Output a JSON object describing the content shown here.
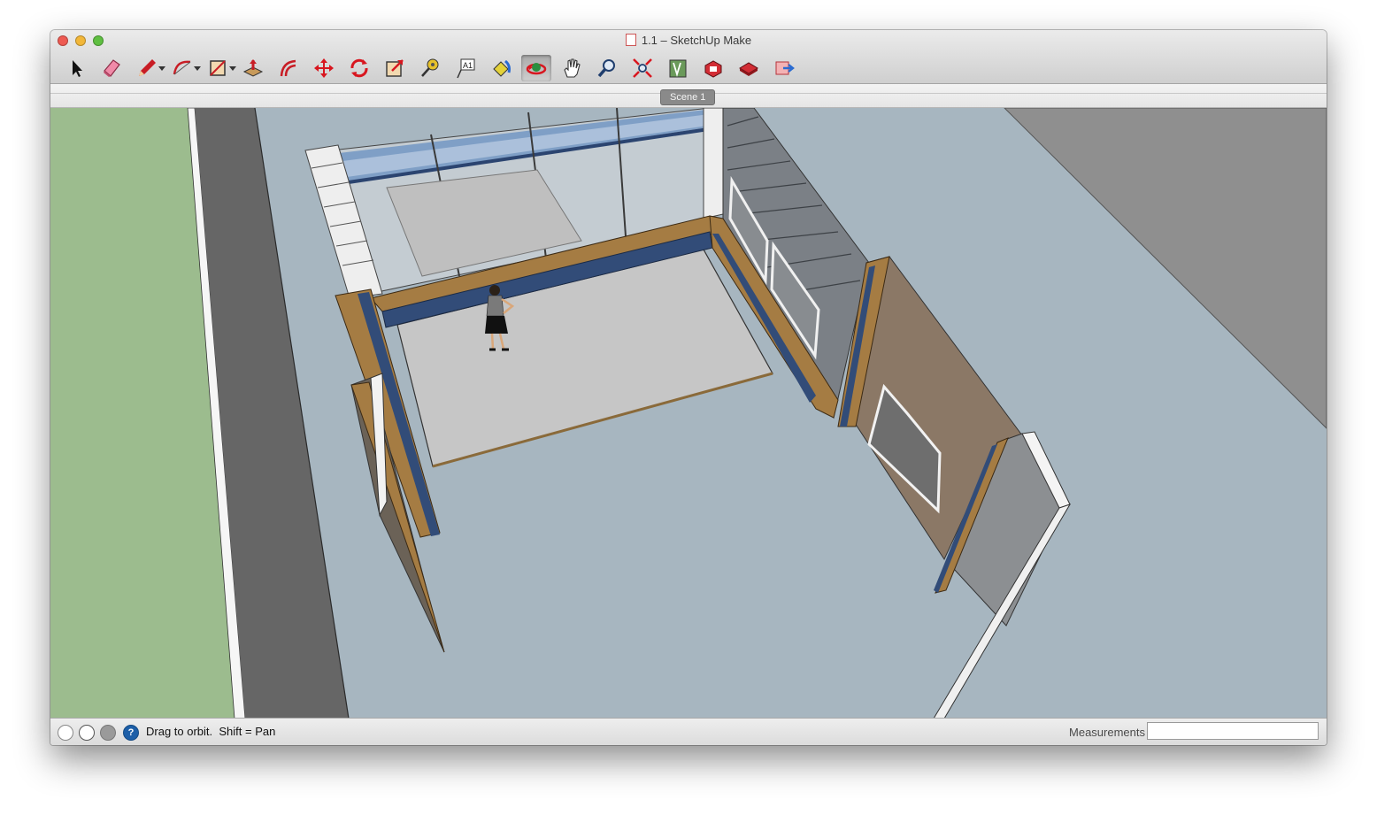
{
  "window": {
    "title": "1.1 – SketchUp Make"
  },
  "toolbar": {
    "tools": [
      {
        "name": "select-tool",
        "icon": "arrow-cursor-icon"
      },
      {
        "name": "eraser-tool",
        "icon": "eraser-icon"
      },
      {
        "name": "line-tool",
        "icon": "pencil-icon",
        "dropdown": true
      },
      {
        "name": "arc-tool",
        "icon": "arc-icon",
        "dropdown": true
      },
      {
        "name": "rectangle-tool",
        "icon": "rectangle-icon",
        "dropdown": true
      },
      {
        "name": "push-pull-tool",
        "icon": "push-pull-icon"
      },
      {
        "name": "offset-tool",
        "icon": "offset-icon"
      },
      {
        "name": "move-tool",
        "icon": "move-arrows-icon"
      },
      {
        "name": "rotate-tool",
        "icon": "rotate-icon"
      },
      {
        "name": "scale-tool",
        "icon": "scale-icon"
      },
      {
        "name": "tape-measure-tool",
        "icon": "tape-measure-icon"
      },
      {
        "name": "text-tool",
        "icon": "text-label-icon"
      },
      {
        "name": "paint-bucket-tool",
        "icon": "paint-bucket-icon"
      },
      {
        "name": "orbit-tool",
        "icon": "orbit-icon",
        "active": true
      },
      {
        "name": "pan-tool",
        "icon": "hand-icon"
      },
      {
        "name": "zoom-tool",
        "icon": "magnifier-icon"
      },
      {
        "name": "zoom-extents-tool",
        "icon": "zoom-extents-icon"
      },
      {
        "name": "3d-warehouse-tool",
        "icon": "warehouse-icon"
      },
      {
        "name": "extension-warehouse-tool",
        "icon": "extension-icon"
      },
      {
        "name": "share-model-tool",
        "icon": "share-model-icon"
      },
      {
        "name": "share-component-tool",
        "icon": "share-component-icon"
      }
    ]
  },
  "scenes": {
    "tabs": [
      "Scene 1"
    ]
  },
  "status": {
    "hint": "Drag to orbit.  Shift = Pan",
    "measurements_label": "Measurements",
    "measurements_value": ""
  },
  "colors": {
    "sky_ground": "#a7b6c0",
    "grass": "#9cbc8e",
    "road": "#666666",
    "wood": "#a57c43",
    "blue_trim": "#324c78",
    "floor": "#c6c6c6"
  }
}
